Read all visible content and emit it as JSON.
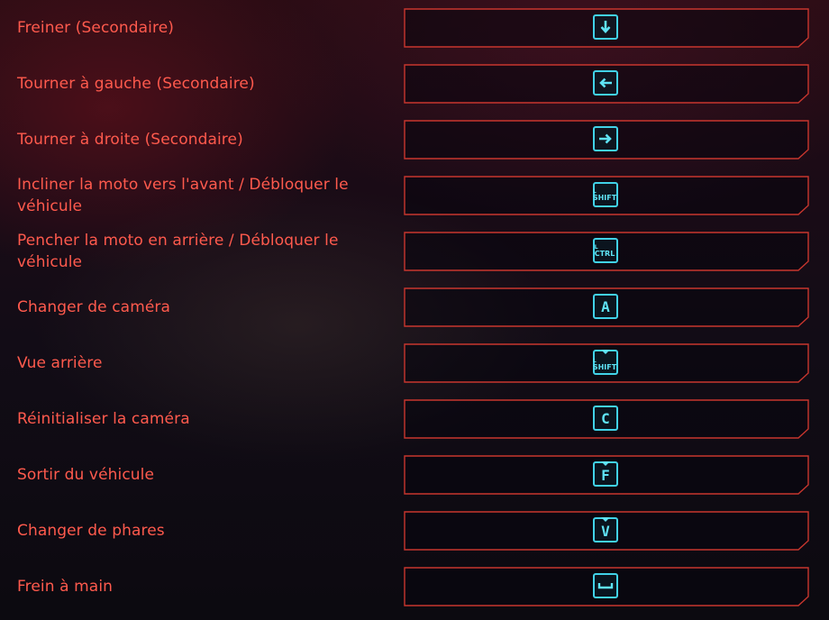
{
  "colors": {
    "label": "#ff5a4d",
    "frame": "#c8362e",
    "key": "#41d2e8"
  },
  "bindings": [
    {
      "label": "Freiner (Secondaire)",
      "key_icon": "arrow-down-icon",
      "key_text": ""
    },
    {
      "label": "Tourner à gauche (Secondaire)",
      "key_icon": "arrow-left-icon",
      "key_text": ""
    },
    {
      "label": "Tourner à droite (Secondaire)",
      "key_icon": "arrow-right-icon",
      "key_text": ""
    },
    {
      "label": "Incliner la moto vers l'avant / Débloquer le véhicule",
      "key_icon": "left-shift-key-icon",
      "key_text": "SHIFT",
      "key_sub": "L"
    },
    {
      "label": "Pencher la moto en arrière / Débloquer le véhicule",
      "key_icon": "left-ctrl-key-icon",
      "key_text": "CTRL",
      "key_sub": "L"
    },
    {
      "label": "Changer de caméra",
      "key_icon": "key-icon",
      "key_text": "A"
    },
    {
      "label": "Vue arrière",
      "key_icon": "hold-left-shift-key-icon",
      "key_text": "SHIFT",
      "key_sub": "L"
    },
    {
      "label": "Réinitialiser la caméra",
      "key_icon": "key-icon",
      "key_text": "C"
    },
    {
      "label": "Sortir du véhicule",
      "key_icon": "hold-key-icon",
      "key_text": "F"
    },
    {
      "label": "Changer de phares",
      "key_icon": "hold-key-icon",
      "key_text": "V"
    },
    {
      "label": "Frein à main",
      "key_icon": "spacebar-icon",
      "key_text": ""
    }
  ]
}
